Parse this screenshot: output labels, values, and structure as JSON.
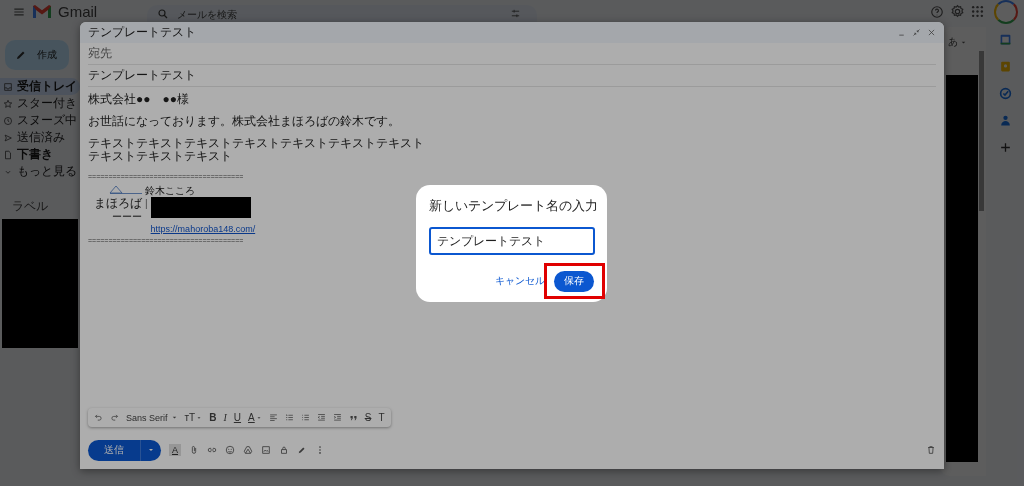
{
  "topbar": {
    "app_name": "Gmail",
    "search": {
      "placeholder": "メールを検索"
    }
  },
  "sidebar": {
    "compose_label": "作成",
    "items": [
      {
        "kind": "inbox",
        "label": "受信トレイ",
        "selected": true,
        "bold": true
      },
      {
        "kind": "star",
        "label": "スター付き",
        "selected": false,
        "bold": false
      },
      {
        "kind": "clock",
        "label": "スヌーズ中",
        "selected": false,
        "bold": false
      },
      {
        "kind": "send",
        "label": "送信済み",
        "selected": false,
        "bold": false
      },
      {
        "kind": "file",
        "label": "下書き",
        "selected": false,
        "bold": true
      },
      {
        "kind": "chevron",
        "label": "もっと見る",
        "selected": false,
        "bold": false
      }
    ],
    "labels_heading": "ラベル"
  },
  "side_panel": {
    "input_mode": "あ"
  },
  "compose": {
    "title": "テンプレートテスト",
    "to_label": "宛先",
    "subject": "テンプレートテスト",
    "paragraphs": [
      [
        "株式会社●●　●●様"
      ],
      [
        "お世話になっております。株式会社まほろばの鈴木です。"
      ],
      [
        "テキストテキストテキストテキストテキストテキストテキスト",
        "テキストテキストテキスト"
      ]
    ],
    "separator_top": "======================================",
    "signature": {
      "name": "鈴木こころ",
      "company": "まほろば",
      "bar": "|",
      "dash": "ーーー",
      "link": "https://mahoroba148.com/"
    },
    "separator_bottom": "======================================",
    "toolbar": {
      "font": "Sans Serif",
      "letters": [
        {
          "kind": "size",
          "text": "тT"
        },
        {
          "kind": "bold",
          "text": "B"
        },
        {
          "kind": "italic",
          "text": "I"
        },
        {
          "kind": "underline",
          "text": "U"
        },
        {
          "kind": "color",
          "text": "A"
        },
        {
          "kind": "strike",
          "text": "S"
        },
        {
          "kind": "clear",
          "text": "T"
        }
      ]
    },
    "send_label": "送信",
    "format_toggle": "A"
  },
  "dialog": {
    "title": "新しいテンプレート名の入力",
    "value": "テンプレートテスト",
    "cancel_label": "キャンセル",
    "save_label": "保存",
    "save_highlighted": true
  }
}
